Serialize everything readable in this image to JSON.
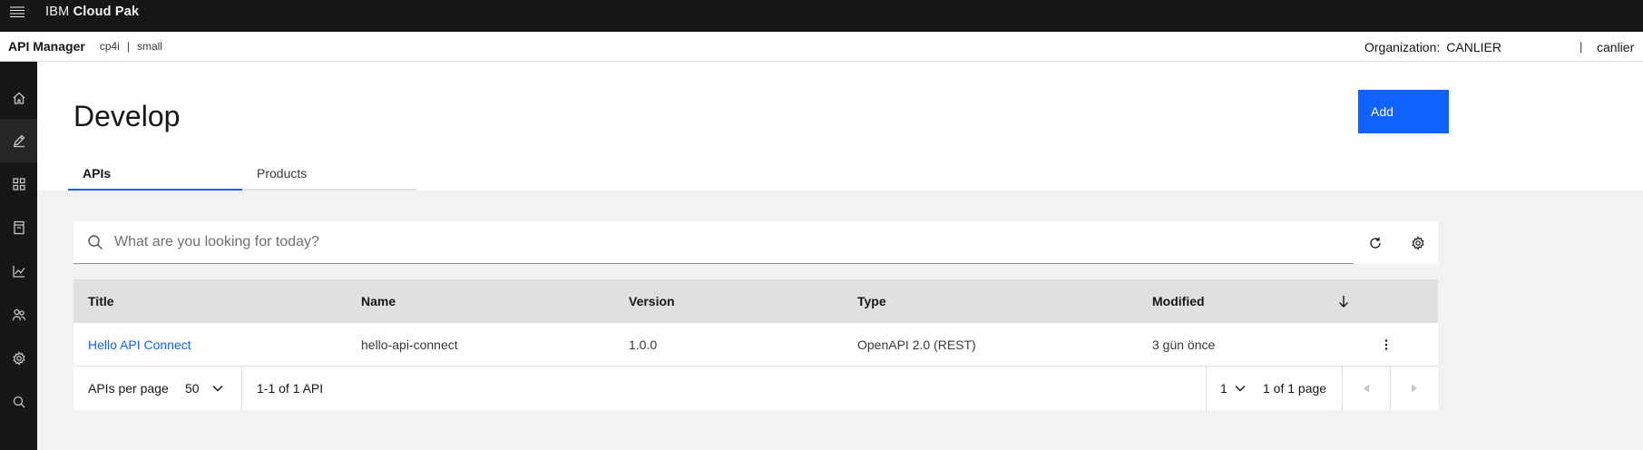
{
  "topbar": {
    "brand_prefix": "IBM",
    "brand_name": "Cloud Pak"
  },
  "subheader": {
    "app_title": "API Manager",
    "crumbs": [
      "cp4i",
      "|",
      "small"
    ],
    "org_label": "Organization:",
    "org_value": "CANLIER",
    "separator": "|",
    "user": "canlier"
  },
  "rail": {
    "items": [
      {
        "icon": "home-icon",
        "active": false
      },
      {
        "icon": "edit-icon",
        "active": true
      },
      {
        "icon": "grid-icon",
        "active": false
      },
      {
        "icon": "catalog-icon",
        "active": false
      },
      {
        "icon": "analytics-icon",
        "active": false
      },
      {
        "icon": "users-icon",
        "active": false
      },
      {
        "icon": "settings-icon",
        "active": false
      },
      {
        "icon": "search-icon",
        "active": false
      }
    ]
  },
  "page": {
    "title": "Develop",
    "add_label": "Add",
    "tabs": [
      {
        "label": "APIs",
        "active": true
      },
      {
        "label": "Products",
        "active": false
      }
    ]
  },
  "search": {
    "placeholder": "What are you looking for today?",
    "value": ""
  },
  "table": {
    "columns": [
      "Title",
      "Name",
      "Version",
      "Type",
      "Modified"
    ],
    "sort_icon": "arrow-down-icon",
    "rows": [
      {
        "title": "Hello API Connect",
        "name": "hello-api-connect",
        "version": "1.0.0",
        "type": "OpenAPI 2.0 (REST)",
        "modified": "3 gün önce"
      }
    ]
  },
  "pagination": {
    "per_page_label": "APIs per page",
    "per_page_value": "50",
    "range_text": "1-1 of 1 API",
    "page_value": "1",
    "page_total": "1 of 1 page"
  },
  "colors": {
    "accent": "#0f62fe",
    "topbar": "#161616",
    "header_row": "#e0e0e0",
    "content_bg": "#f2f2f2"
  }
}
